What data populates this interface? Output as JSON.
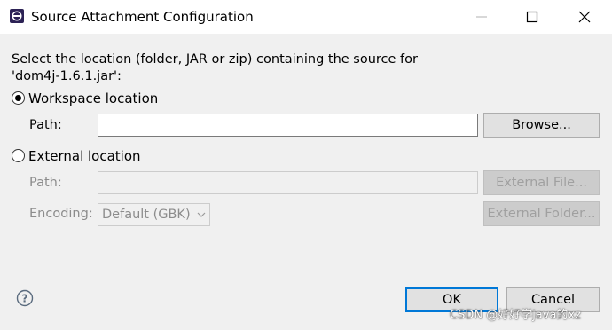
{
  "window": {
    "title": "Source Attachment Configuration",
    "minimize_icon": "minimize-icon",
    "maximize_icon": "maximize-icon",
    "close_icon": "close-icon"
  },
  "prompt": {
    "line1": "Select the location (folder, JAR or zip) containing the source for",
    "line2": "'dom4j-1.6.1.jar':"
  },
  "workspace": {
    "label": "Workspace location",
    "selected": true,
    "path_label": "Path:",
    "path_value": "",
    "browse_label": "Browse..."
  },
  "external": {
    "label": "External location",
    "selected": false,
    "path_label": "Path:",
    "path_value": "",
    "external_file_label": "External File...",
    "encoding_label": "Encoding:",
    "encoding_value": "Default (GBK)",
    "external_folder_label": "External Folder..."
  },
  "footer": {
    "help_icon": "help-icon",
    "ok_label": "OK",
    "cancel_label": "Cancel"
  },
  "watermark": "CSDN @好好学java的xz",
  "colors": {
    "accent": "#0078d7",
    "dialog_bg": "#f0f0f0",
    "title_bg": "#ffffff"
  }
}
